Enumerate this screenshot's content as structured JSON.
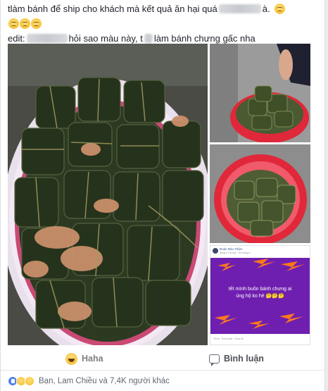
{
  "post": {
    "line1_a": "t",
    "line1_b": " làm bánh để ship cho khách mà kết quả ăn hại quá",
    "line1_c": "à.",
    "line2_a": "edit:",
    "line2_b": "hỏi sao màu này, t",
    "line2_c": " làm bánh chưng gấc nha"
  },
  "embedded_post": {
    "author": "Đoàn Bảo Thiện",
    "meta": "đang ở Hà Nội · 26 tháng 9",
    "text_line1": "tết mình buôn bánh chưng ai",
    "text_line2": "ủng hộ ko hè 🤔🤔🤔",
    "footer": "Thích · Bình luận · Chia sẻ"
  },
  "actions": {
    "haha_label": "Haha",
    "comment_label": "Bình luận"
  },
  "summary": {
    "text": "Bạn, Lam Chiều và 7,4K người khác"
  },
  "colors": {
    "haha_text": "#7f7f7f",
    "purple_bg": "#6f1fb0",
    "lightning": "#ff7a1a",
    "basket_red": "#e0283a"
  },
  "icons": [
    "smiley-sad-icon",
    "haha-icon",
    "comment-icon",
    "like-reaction-icon",
    "haha-reaction-icon",
    "sad-reaction-icon"
  ]
}
